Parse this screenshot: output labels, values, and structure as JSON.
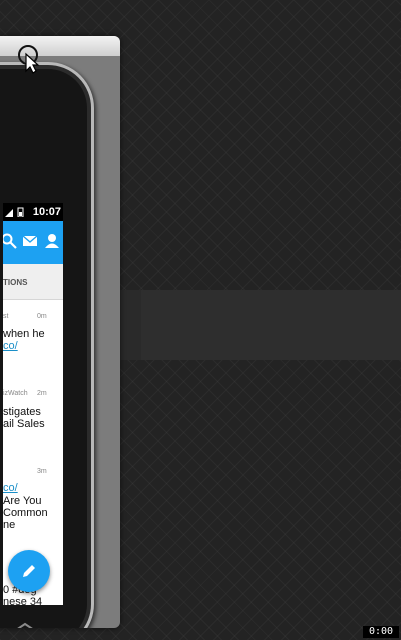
{
  "status_bar": {
    "time": "10:07"
  },
  "app_bar": {
    "icons": [
      "search-icon",
      "messages-icon",
      "profile-icon"
    ],
    "accent_color": "#1da1f2"
  },
  "tabs": {
    "active_label": "TIONS"
  },
  "feed": [
    {
      "meta_left": "st",
      "time": "0m",
      "lines": [
        "when he"
      ],
      "link": "co/"
    },
    {
      "meta_left": "izWatch",
      "time": "2m",
      "lines": [
        "stigates",
        "ail Sales"
      ]
    },
    {
      "meta_left": "",
      "time": "3m",
      "link": "co/",
      "lines": [
        " Are You",
        " Common",
        "ne"
      ]
    },
    {
      "meta_left": "",
      "time": "",
      "lines": [
        "0 #dog",
        "nese 34"
      ]
    }
  ],
  "fab": {
    "icon": "compose-icon"
  },
  "nav": {
    "icon": "home-icon"
  },
  "corner_clock": "0:00"
}
